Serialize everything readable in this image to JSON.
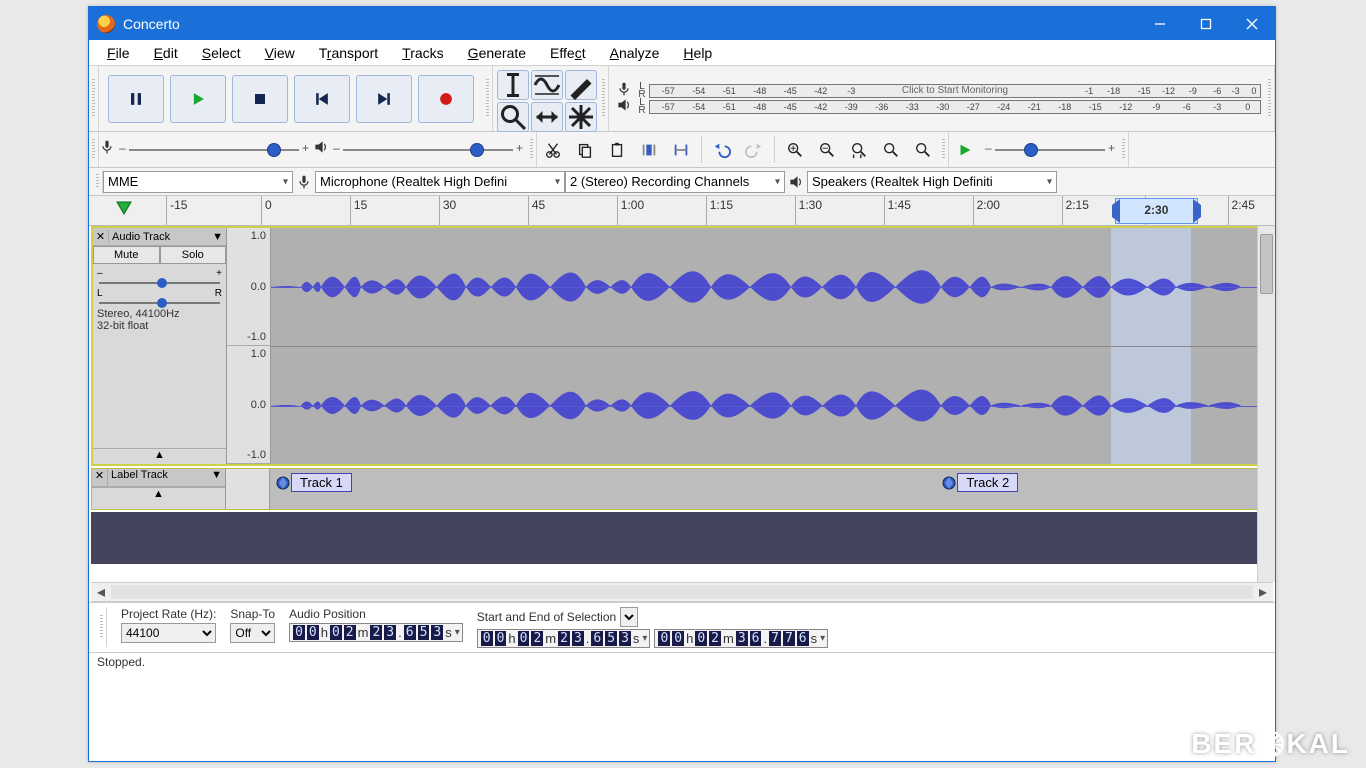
{
  "window": {
    "title": "Concerto"
  },
  "menu": [
    "File",
    "Edit",
    "Select",
    "View",
    "Transport",
    "Tracks",
    "Generate",
    "Effect",
    "Analyze",
    "Help"
  ],
  "meter": {
    "rec_hint": "Click to Start Monitoring",
    "ticks": [
      "-57",
      "-54",
      "-51",
      "-48",
      "-45",
      "-42",
      "-39",
      "-36",
      "-33",
      "-30",
      "-27",
      "-24",
      "-21",
      "-18",
      "-15",
      "-12",
      "-9",
      "-6",
      "-3",
      "0"
    ],
    "ticks_right": [
      "-18",
      "-15",
      "-12",
      "-9",
      "-6",
      "-3",
      "0"
    ]
  },
  "devices": {
    "host": "MME",
    "input": "Microphone (Realtek High Defini",
    "channels": "2 (Stereo) Recording Channels",
    "output": "Speakers (Realtek High Definiti"
  },
  "ruler": {
    "labels": [
      "-15",
      "0",
      "15",
      "30",
      "45",
      "1:00",
      "1:15",
      "1:30",
      "1:45",
      "2:00",
      "2:15",
      "2:30",
      "2:45"
    ],
    "selection_label": "2:30"
  },
  "audiotrack": {
    "name": "Audio Track",
    "mute": "Mute",
    "solo": "Solo",
    "gain_left": "–",
    "gain_right": "+",
    "pan_left": "L",
    "pan_right": "R",
    "info1": "Stereo, 44100Hz",
    "info2": "32-bit float",
    "scale": [
      "1.0",
      "0.0",
      "-1.0"
    ]
  },
  "labeltrack": {
    "name": "Label Track",
    "labels": [
      {
        "text": "Track 1",
        "pos_pct": 2
      },
      {
        "text": "Track 2",
        "pos_pct": 68
      }
    ]
  },
  "selectionbar": {
    "rate_label": "Project Rate (Hz):",
    "rate_value": "44100",
    "snap_label": "Snap-To",
    "snap_value": "Off",
    "pos_label": "Audio Position",
    "sel_label": "Start and End of Selection",
    "pos_value": [
      "0",
      "0",
      "h",
      "0",
      "2",
      "m",
      "2",
      "3",
      ".",
      "6",
      "5",
      "3",
      "s"
    ],
    "sel_start": [
      "0",
      "0",
      "h",
      "0",
      "2",
      "m",
      "2",
      "3",
      ".",
      "6",
      "5",
      "3",
      "s"
    ],
    "sel_end": [
      "0",
      "0",
      "h",
      "0",
      "2",
      "m",
      "3",
      "6",
      ".",
      "7",
      "7",
      "6",
      "s"
    ]
  },
  "status": "Stopped.",
  "watermark": "BER KAL"
}
